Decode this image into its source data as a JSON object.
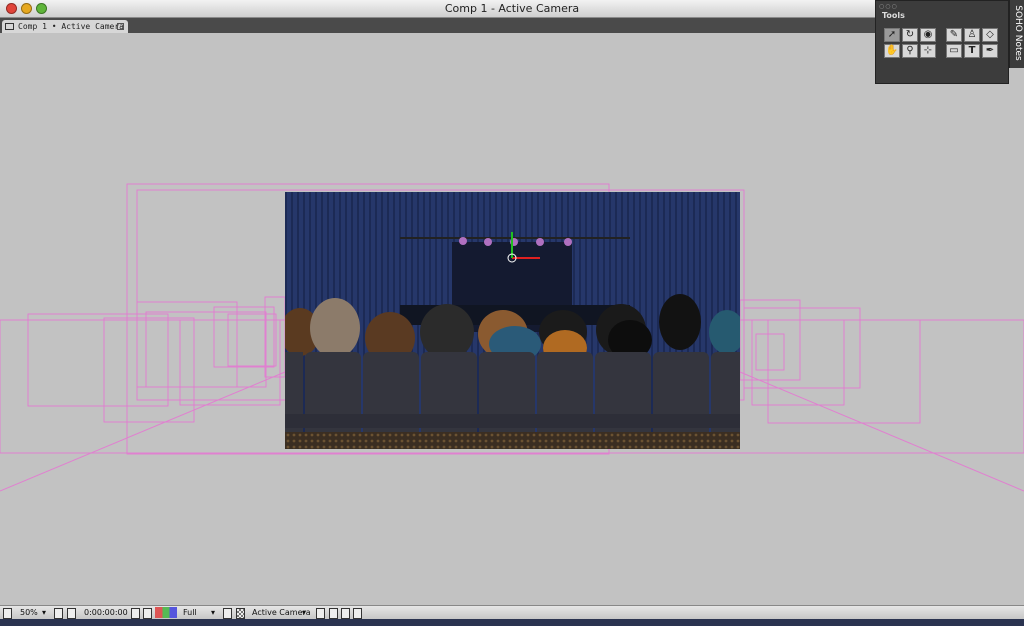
{
  "window": {
    "title": "Comp 1 - Active Camera",
    "tab_label": "Comp 1 • Active Camera"
  },
  "tools_palette": {
    "title": "Tools",
    "tools": [
      "selection",
      "rotation",
      "orbit-camera",
      "brush",
      "clone-stamp",
      "eraser",
      "hand",
      "zoom",
      "pan-behind",
      "mask",
      "text",
      "pen"
    ],
    "selected": "selection"
  },
  "side_panel": {
    "label": "SOHO Notes"
  },
  "bottom_bar": {
    "zoom": "50%",
    "timecode": "0:00:00:00",
    "resolution": "Full",
    "view": "Active Camera"
  },
  "colors": {
    "workspace": "#c2c2c2",
    "layer_outline": "#e080d0",
    "curtain": "#233463",
    "seat": "#35363f",
    "floor": "#4a3a26"
  }
}
